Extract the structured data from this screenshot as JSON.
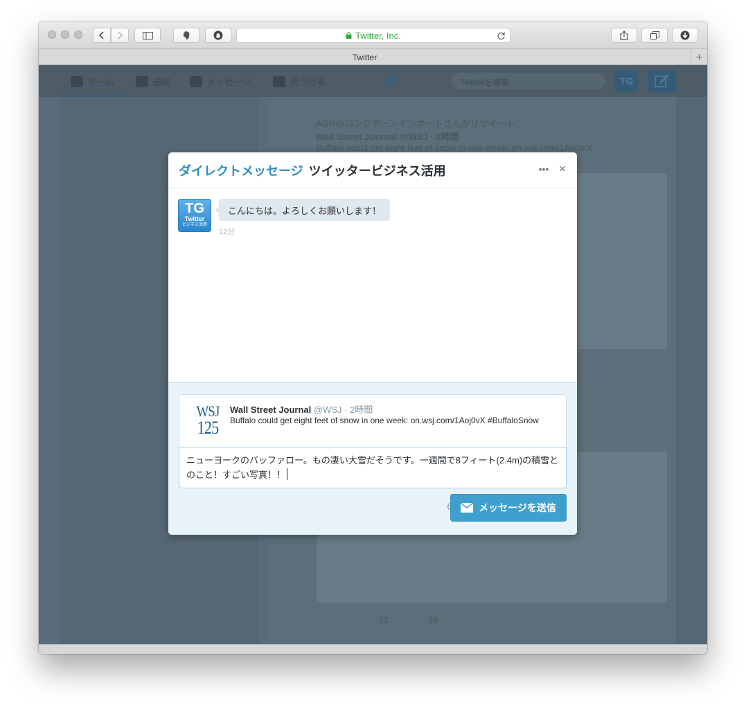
{
  "browser": {
    "url_text": "Twitter, Inc.",
    "tab_title": "Twitter",
    "new_tab_label": "+"
  },
  "background": {
    "nav": {
      "home": "ホーム",
      "notifications": "通知",
      "messages": "メッセージ",
      "discover": "見つける",
      "search_placeholder": "Twitterを検索",
      "avatar_label": "TG"
    },
    "retweet_line": "AGR@ロングボーンインポートさんがリツイート",
    "tweet_head": "Wall Street Journal @WSJ · 2時間",
    "tweet_text": "Buffalo could get eight feet of snow in one week: on.wsj.com/1Aoj0vX",
    "retweet_count": "31",
    "favorite_count": "38"
  },
  "modal": {
    "title_prefix": "ダイレクトメッセージ",
    "title_name": "ツイッタービジネス活用",
    "more_label": "•••",
    "close_label": "×",
    "conversation": {
      "avatar": {
        "line1": "TG",
        "line2": "Twitter",
        "line3": "ビジネス活用"
      },
      "message_text": "こんにちは。よろしくお願いします！",
      "message_time": "12分"
    },
    "compose": {
      "quote": {
        "logo_line1": "WSJ",
        "logo_line2": "125",
        "author_name": "Wall Street Journal",
        "author_meta": "@WSJ · 2時間",
        "text": "Buffalo could get eight feet of snow in one week: on.wsj.com/1Aoj0vX #BuffaloSnow"
      },
      "message_value": "ニューヨークのバッファロー。もの凄い大雪だそうです。一週間で8フィート(2.4m)の積雪とのこと！すごい写真！！",
      "char_counter": "60",
      "send_label": "メッセージを送信"
    }
  },
  "colors": {
    "accent": "#2d8ec4",
    "send_button": "#3fa0cf",
    "url_secure": "#2eaa3c",
    "overlay": "#5a6c7a"
  }
}
